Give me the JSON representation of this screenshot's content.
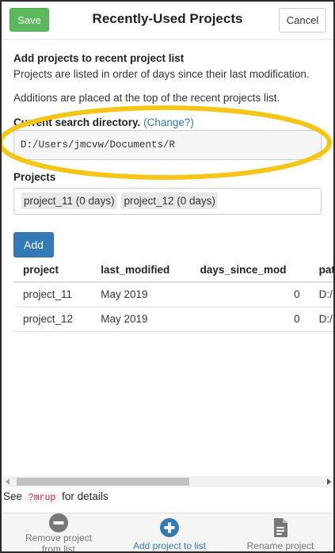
{
  "header": {
    "title": "Recently-Used Projects",
    "save_label": "Save",
    "cancel_label": "Cancel"
  },
  "intro": {
    "heading": "Add projects to recent project list",
    "line1": "Projects are listed in order of days since their last modification.",
    "line2": "Additions are placed at the top of the recent projects list."
  },
  "search_dir": {
    "label": "Current search directory.",
    "change_link": "(Change?)",
    "value": "D:/Users/jmcvw/Documents/R"
  },
  "projects": {
    "label": "Projects",
    "selected": [
      "project_11 (0 days)",
      "project_12 (0 days)"
    ],
    "add_label": "Add"
  },
  "table": {
    "columns": [
      "project",
      "last_modified",
      "days_since_mod",
      "path"
    ],
    "rows": [
      [
        "project_11",
        "May 2019",
        "0",
        "D:/Users"
      ],
      [
        "project_12",
        "May 2019",
        "0",
        "D:/Users"
      ]
    ]
  },
  "footer_note": {
    "prefix": "See",
    "code": "?mrup",
    "suffix": "for details"
  },
  "toolbar": {
    "remove_label": "Remove project from list",
    "add_label": "Add project to list",
    "rename_label": "Rename project"
  },
  "colors": {
    "save": "#5cb85c",
    "add": "#337ab7",
    "highlight": "#f5c518"
  },
  "icons": {
    "remove": "minus-circle-icon",
    "add": "plus-circle-icon",
    "rename": "document-icon"
  }
}
